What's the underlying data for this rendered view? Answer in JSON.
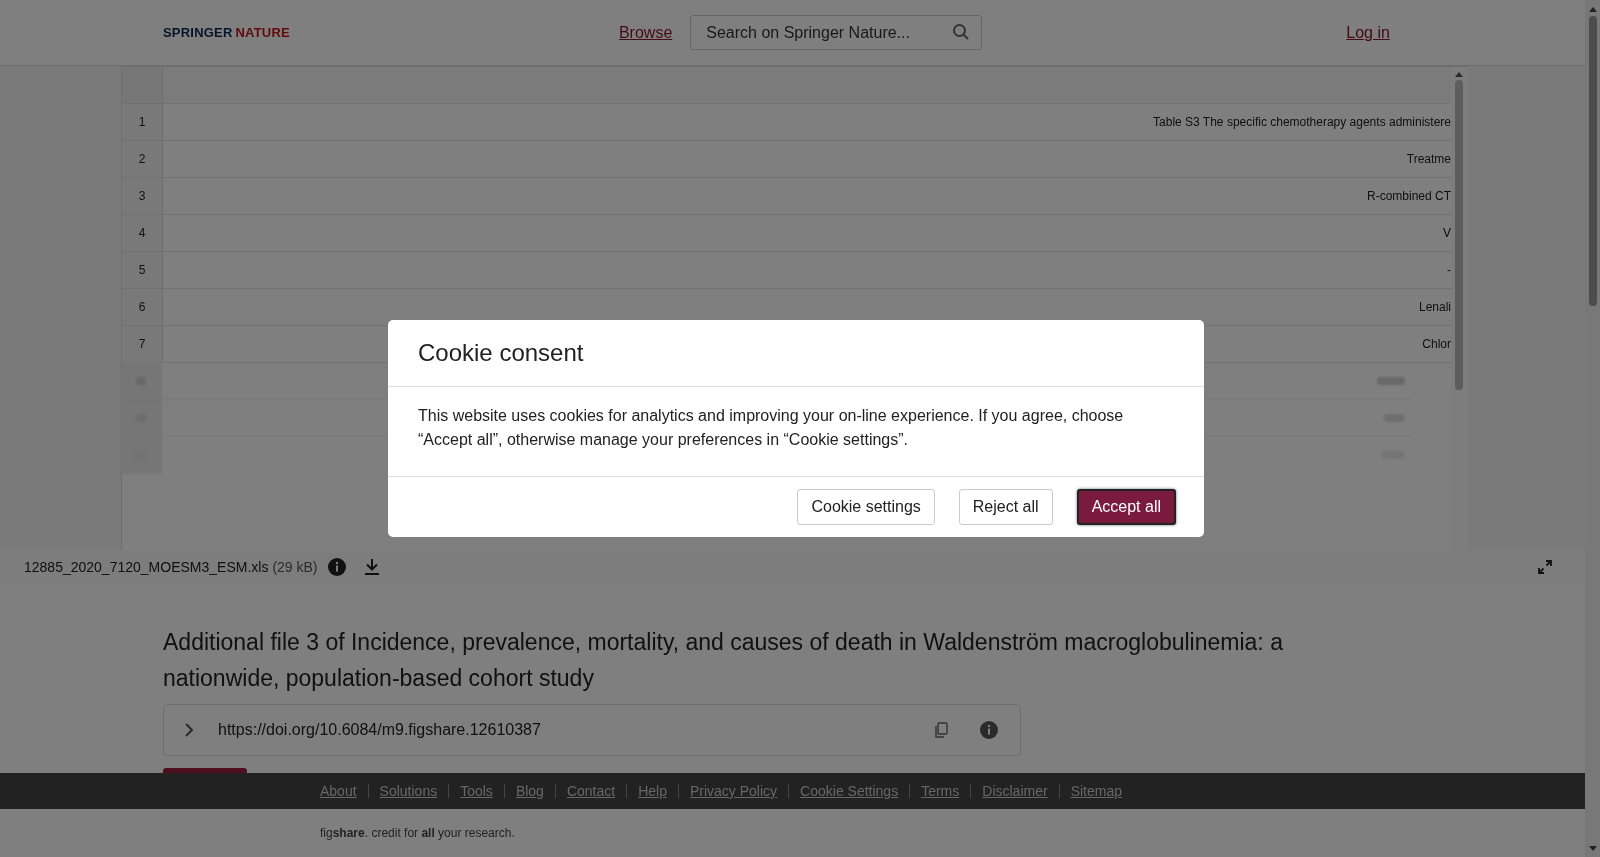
{
  "header": {
    "logo": {
      "first": "SPRINGER",
      "second": "NATURE"
    },
    "browse_link": "Browse",
    "search": {
      "placeholder": "Search on Springer Nature..."
    },
    "login_link": "Log in"
  },
  "spreadsheet": {
    "rows": [
      {
        "number": "1",
        "cell": "Table S3 The specific chemotherapy agents administere"
      },
      {
        "number": "2",
        "cell": "Treatme"
      },
      {
        "number": "3",
        "cell": "R-combined CT"
      },
      {
        "number": "4",
        "cell": "V"
      },
      {
        "number": "5",
        "cell": "-"
      },
      {
        "number": "6",
        "cell": "Lenali"
      },
      {
        "number": "7",
        "cell": "Chlor"
      }
    ]
  },
  "file_bar": {
    "filename": "12885_2020_7120_MOESM3_ESM.xls",
    "size": "(29 kB)"
  },
  "item": {
    "title": "Additional file 3 of Incidence, prevalence, mortality, and causes of death in Waldenström macroglobulinemia: a nationwide, population-based cohort study",
    "doi": "https://doi.org/10.6084/m9.figshare.12610387"
  },
  "footer": {
    "links": [
      "About",
      "Solutions",
      "Tools",
      "Blog",
      "Contact",
      "Help",
      "Privacy Policy",
      "Cookie Settings",
      "Terms",
      "Disclaimer",
      "Sitemap"
    ],
    "tagline": "fig**share**. credit for **all** your research."
  },
  "cookie_dialog": {
    "title": "Cookie consent",
    "body": "This website uses cookies for analytics and improving your on-line experience. If you agree, choose “Accept all”, otherwise manage your preferences in “Cookie settings”.",
    "buttons": [
      {
        "label": "Cookie settings",
        "kind": "secondary"
      },
      {
        "label": "Reject all",
        "kind": "secondary"
      },
      {
        "label": "Accept all",
        "kind": "primary"
      }
    ]
  }
}
